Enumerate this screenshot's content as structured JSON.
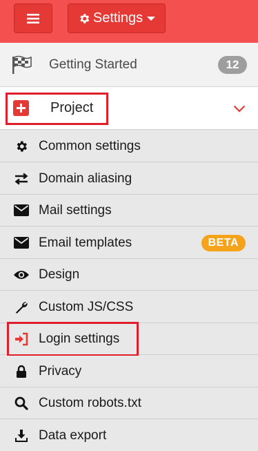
{
  "topbar": {
    "settings_label": "Settings"
  },
  "getting_started": {
    "label": "Getting Started",
    "count": "12"
  },
  "project": {
    "label": "Project"
  },
  "menu_items": [
    {
      "label": "Common settings",
      "icon": "gear-icon"
    },
    {
      "label": "Domain aliasing",
      "icon": "exchange-arrows-icon"
    },
    {
      "label": "Mail settings",
      "icon": "envelope-icon"
    },
    {
      "label": "Email templates",
      "icon": "envelope-icon",
      "badge": "BETA"
    },
    {
      "label": "Design",
      "icon": "eye-icon"
    },
    {
      "label": "Custom JS/CSS",
      "icon": "wrench-icon"
    },
    {
      "label": "Login settings",
      "icon": "sign-in-icon"
    },
    {
      "label": "Privacy",
      "icon": "lock-icon"
    },
    {
      "label": "Custom robots.txt",
      "icon": "search-icon"
    },
    {
      "label": "Data export",
      "icon": "download-icon"
    }
  ],
  "colors": {
    "topbar": "#f3504f",
    "button": "#e53935",
    "highlight": "#e01e2b",
    "beta": "#f5a31a",
    "count_badge": "#9e9e9e"
  }
}
